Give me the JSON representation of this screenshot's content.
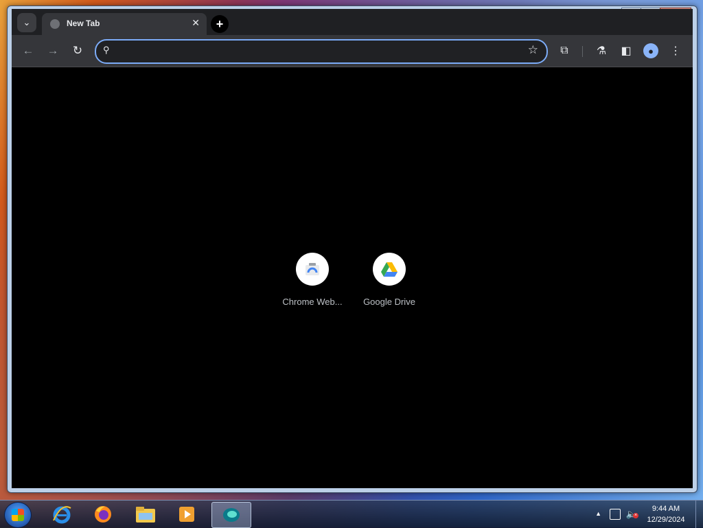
{
  "browser": {
    "tab": {
      "title": "New Tab",
      "close_glyph": "✕"
    },
    "new_tab_glyph": "+",
    "tab_search_glyph": "⌄",
    "toolbar": {
      "back_glyph": "←",
      "forward_glyph": "→",
      "reload_glyph": "↻",
      "omnibox_value": "",
      "omnibox_placeholder": "",
      "search_glyph": "⚲",
      "star_glyph": "☆",
      "extensions_glyph": "⧉",
      "labs_glyph": "⚗",
      "sidepanel_glyph": "◧",
      "menu_glyph": "⋮"
    },
    "shortcuts": [
      {
        "label": "Chrome Web...",
        "icon": "chrome-web-store-icon"
      },
      {
        "label": "Google Drive",
        "icon": "google-drive-icon"
      }
    ]
  },
  "window_controls": {
    "minimize": "–",
    "maximize": "□",
    "close": "✕"
  },
  "taskbar": {
    "apps": [
      "internet-explorer-icon",
      "firefox-icon",
      "file-explorer-icon",
      "media-player-icon",
      "browser-app-icon"
    ],
    "clock": {
      "time": "9:44 AM",
      "date": "12/29/2024"
    }
  },
  "colors": {
    "accent": "#7cacf8",
    "toolbar_bg": "#35363a",
    "content_bg": "#000000"
  }
}
